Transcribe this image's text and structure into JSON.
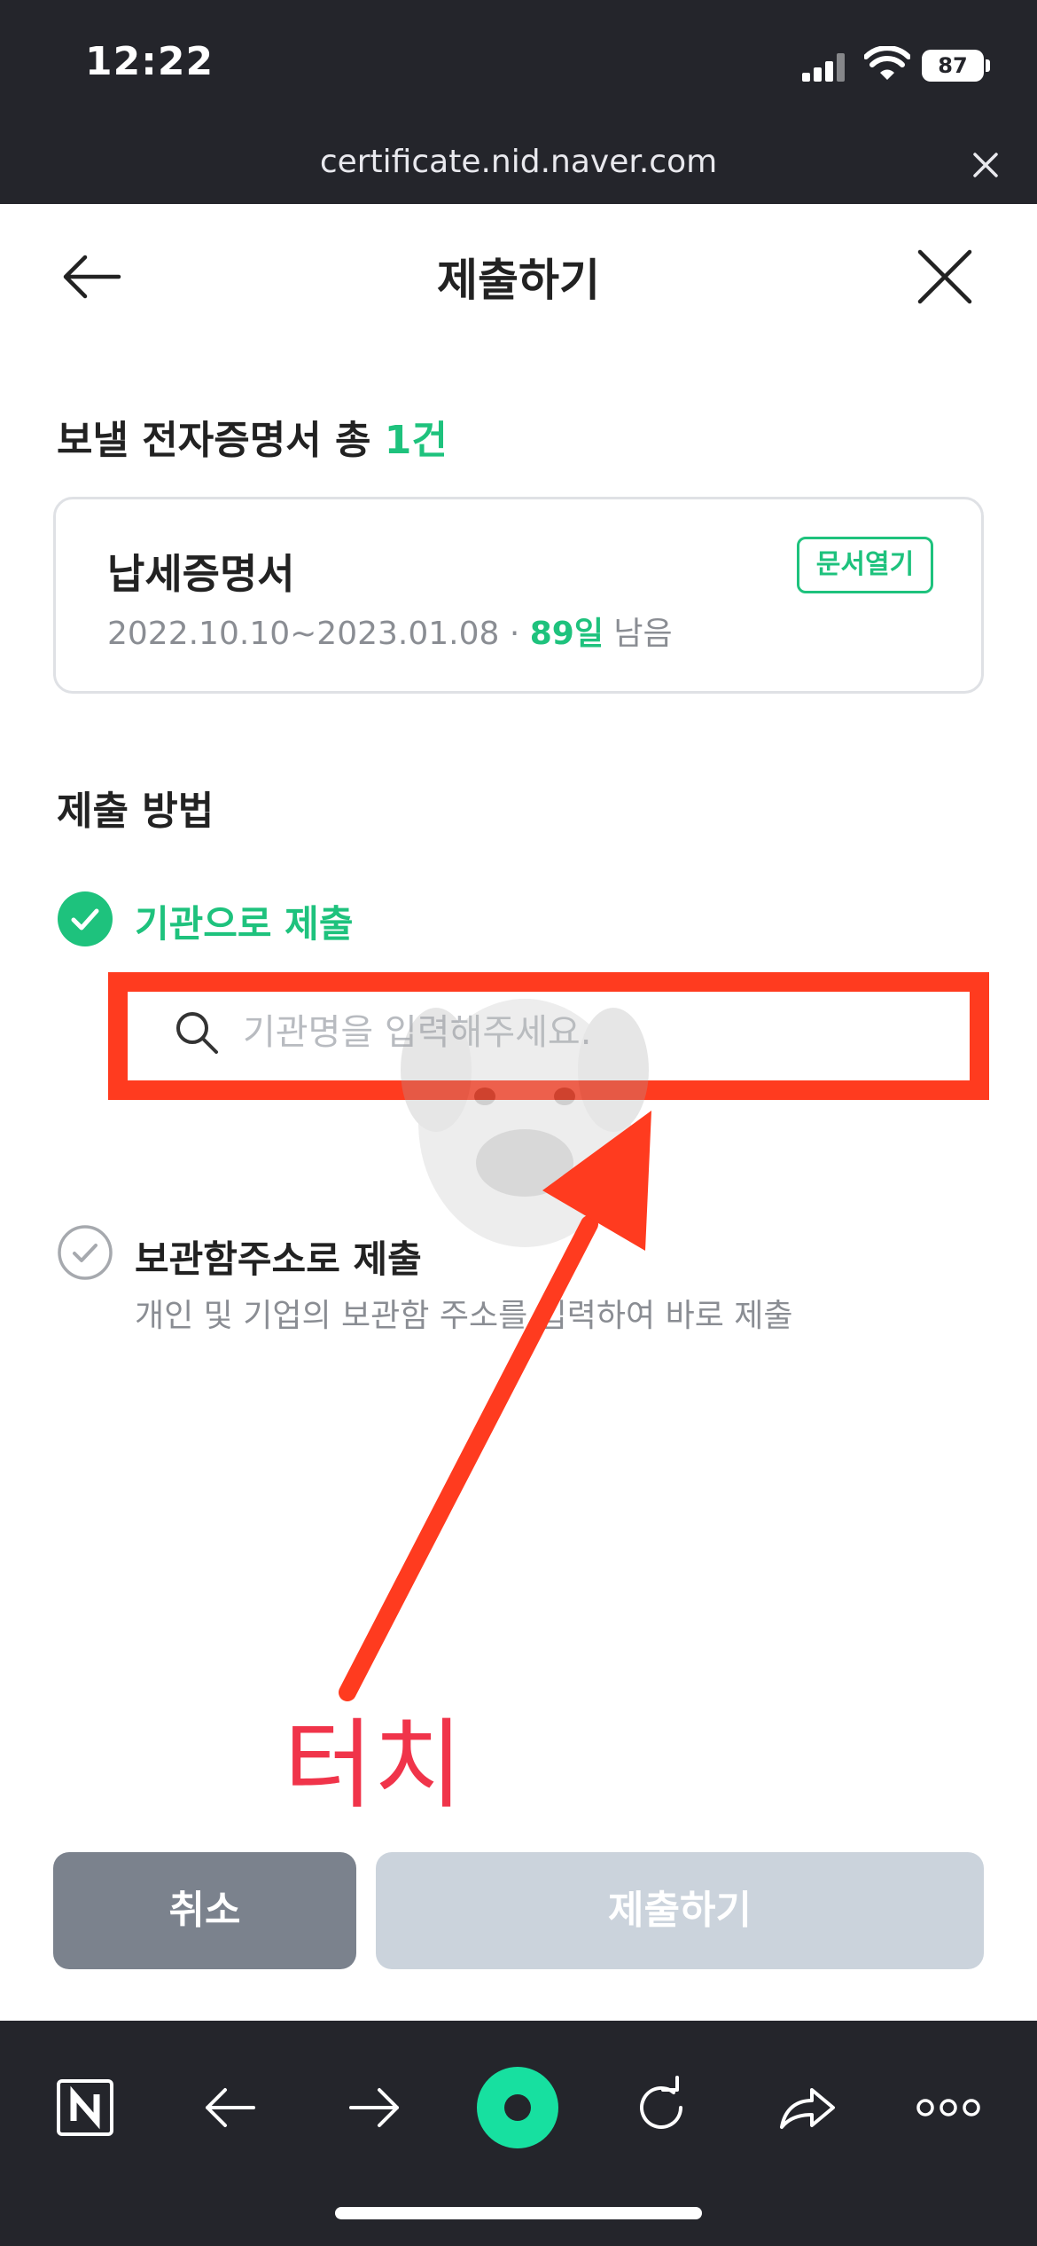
{
  "status_bar": {
    "time": "12:22",
    "battery": "87"
  },
  "browser": {
    "url": "certificate.nid.naver.com"
  },
  "nav": {
    "title": "제출하기"
  },
  "send_section": {
    "heading_prefix": "보낼 전자증명서 총 ",
    "count": "1건"
  },
  "document": {
    "name": "납세증명서",
    "period": "2022.10.10~2023.01.08 · ",
    "days_left_number": "89일",
    "days_left_suffix": " 남음",
    "open_button": "문서열기"
  },
  "method_section": {
    "heading": "제출 방법",
    "option_institution": {
      "label": "기관으로 제출",
      "selected": true
    },
    "search": {
      "placeholder": "기관명을 입력해주세요.",
      "value": ""
    },
    "option_mailbox": {
      "label": "보관함주소로 제출",
      "description": "개인 및 기업의 보관함 주소를 입력하여 바로 제출",
      "selected": false
    }
  },
  "annotation": {
    "touch_label": "터치",
    "color": "#ff3b1f"
  },
  "buttons": {
    "cancel": "취소",
    "submit": "제출하기"
  },
  "colors": {
    "accent_green": "#1ec27d",
    "dark_bar": "#24252b",
    "cancel_button": "#7b828d",
    "submit_disabled": "#cbd3dc"
  },
  "toolbar_icons": [
    "naver-home-icon",
    "back-arrow-icon",
    "forward-arrow-icon",
    "green-dot-icon",
    "refresh-icon",
    "share-icon",
    "more-icon"
  ]
}
